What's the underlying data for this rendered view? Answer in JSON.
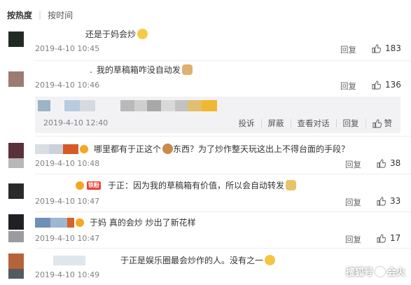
{
  "sort": {
    "active": "按热度",
    "other": "按时间"
  },
  "colors": {
    "time_text": "#808080",
    "divider": "#eeeeee",
    "subbox_bg": "#f2f2f5",
    "vip_badge": "#f5a623",
    "fans_badge": "#e8433a"
  },
  "icons": {
    "like": "thumbs-up-icon",
    "emoji": "smiley-emoji-icon",
    "vip": "vip-badge-icon"
  },
  "comments": [
    {
      "text": "还是于妈会炒",
      "time": "2019-4-10 10:45",
      "reply": "回复",
      "likes": "183"
    },
    {
      "text": "我的草稿箱咋没自动发",
      "time": "2019-4-10 10:46",
      "reply": "回复",
      "likes": "136"
    },
    {
      "text_a": "哪里都有于正这个",
      "text_b": "东西？为了炒作整天玩这出上不得台面的手段？",
      "time": "2019-4-10 10:48",
      "reply": "回复",
      "likes": "38"
    },
    {
      "badge": "铁粉",
      "text": "于正：因为我的草稿箱有价值，所以会自动转发",
      "time": "2019-4-10 10:47",
      "reply": "回复",
      "likes": "33"
    },
    {
      "text": "于妈 真的会炒 炒出了新花样",
      "time": "2019-4-10 10:47",
      "reply": "回复",
      "likes": "17"
    },
    {
      "text": "于正是娱乐圈最会炒作的人。没有之一",
      "time": "2019-4-10 10:49"
    }
  ],
  "subreply": {
    "time": "2019-4-10 12:40",
    "actions": {
      "report": "投诉",
      "block": "屏蔽",
      "view_conversation": "查看对话",
      "reply": "回复",
      "like": "赞"
    }
  },
  "watermark": {
    "left": "搜狐号",
    "right": "会火"
  }
}
